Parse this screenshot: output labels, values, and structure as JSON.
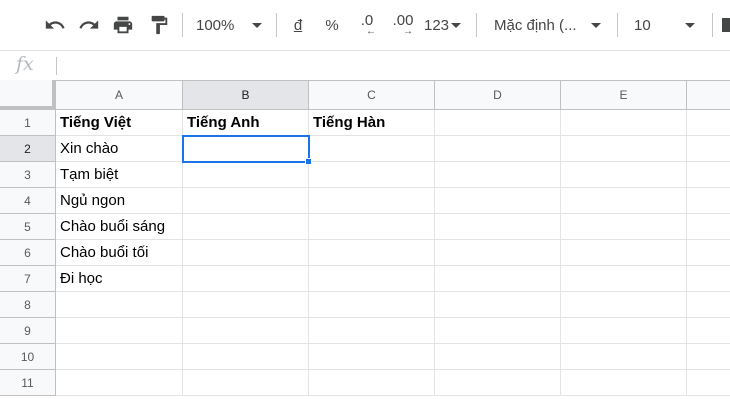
{
  "toolbar": {
    "zoom": "100%",
    "currency": "đ",
    "percent": "%",
    "decrease_decimal": ".0",
    "increase_decimal": ".00",
    "more_formats": "123",
    "font": "Mặc định (...",
    "font_size": "10"
  },
  "formula_bar": {
    "fx_label": "fx",
    "value": ""
  },
  "sheet": {
    "columns": [
      "A",
      "B",
      "C",
      "D",
      "E"
    ],
    "rows": [
      "1",
      "2",
      "3",
      "4",
      "5",
      "6",
      "7",
      "8",
      "9",
      "10",
      "11"
    ],
    "active_cell": "B2",
    "cells": {
      "A1": "Tiếng Việt",
      "B1": "Tiếng Anh",
      "C1": "Tiếng Hàn",
      "A2": "Xin chào",
      "A3": "Tạm biệt",
      "A4": "Ngủ ngon",
      "A5": "Chào buổi sáng",
      "A6": "Chào buổi tối",
      "A7": "Đi học"
    }
  },
  "colors": {
    "selection": "#1a73e8",
    "header_bg": "#f8f9fa",
    "header_active_bg": "#e3e5e8",
    "gridline": "#e2e3e3"
  }
}
